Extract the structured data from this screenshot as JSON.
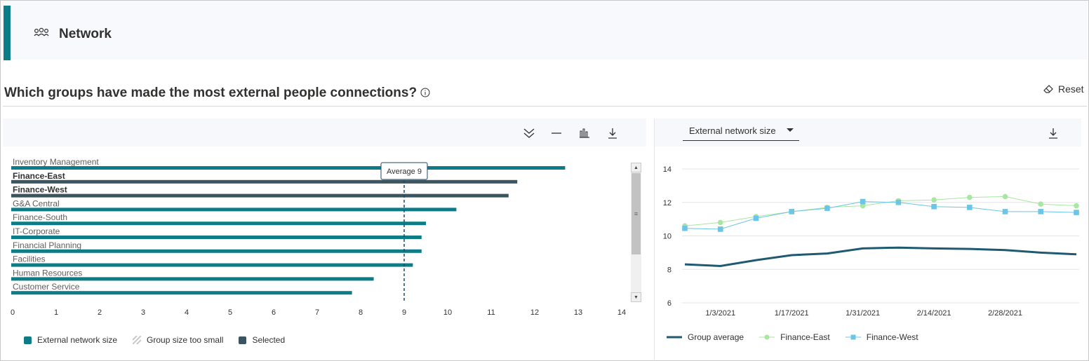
{
  "header": {
    "title": "Network",
    "icon": "people-group-icon"
  },
  "question": {
    "text": "Which groups have made the most external people connections?",
    "info_icon": "info-icon"
  },
  "reset": {
    "label": "Reset",
    "icon": "eraser-icon"
  },
  "left_toolbar": {
    "icons": [
      "expand-all-icon",
      "minimize-icon",
      "bar-chart-icon",
      "download-icon"
    ]
  },
  "right_toolbar": {
    "icons": [
      "download-icon"
    ]
  },
  "colors": {
    "teal": "#0e7c86",
    "selected": "#3a5460",
    "avg_line": "#1d4a66",
    "group_avg": "#1f5a72",
    "finance_east": "#a8e6a1",
    "finance_west": "#6cc4e6"
  },
  "chart_data": [
    {
      "type": "bar",
      "orientation": "horizontal",
      "categories": [
        "Inventory Management",
        "Finance-East",
        "Finance-West",
        "G&A Central",
        "Finance-South",
        "IT-Corporate",
        "Financial Planning",
        "Facilities",
        "Human Resources",
        "Customer Service"
      ],
      "values": [
        12.7,
        11.6,
        11.4,
        10.2,
        9.5,
        9.4,
        9.4,
        9.2,
        8.3,
        7.8
      ],
      "selected": [
        false,
        true,
        true,
        false,
        false,
        false,
        false,
        false,
        false,
        false
      ],
      "xlim": [
        0,
        14
      ],
      "xticks": [
        "0",
        "1",
        "2",
        "3",
        "4",
        "5",
        "6",
        "7",
        "8",
        "9",
        "10",
        "11",
        "12",
        "13",
        "14"
      ],
      "average": {
        "value": 9,
        "label": "Average 9"
      },
      "legend": [
        {
          "label": "External network size",
          "color": "#0e7c86",
          "kind": "solid"
        },
        {
          "label": "Group size too small",
          "color": "#c8c8c8",
          "kind": "hatched"
        },
        {
          "label": "Selected",
          "color": "#3a5460",
          "kind": "solid"
        }
      ]
    },
    {
      "type": "line",
      "metric_selector": "External network size",
      "x": [
        "2020-12-27",
        "2021-01-03",
        "2021-01-10",
        "2021-01-17",
        "2021-01-24",
        "2021-01-31",
        "2021-02-07",
        "2021-02-14",
        "2021-02-21",
        "2021-02-28",
        "2021-03-07",
        "2021-03-14"
      ],
      "xticks": [
        "1/3/2021",
        "1/17/2021",
        "1/31/2021",
        "2/14/2021",
        "2/28/2021"
      ],
      "ylim": [
        6,
        14
      ],
      "yticks": [
        "6",
        "8",
        "10",
        "12",
        "14"
      ],
      "series": [
        {
          "name": "Group average",
          "color": "#1f5a72",
          "marker": "none",
          "values": [
            8.3,
            8.2,
            8.55,
            8.85,
            8.95,
            9.25,
            9.3,
            9.25,
            9.22,
            9.15,
            9.0,
            8.9
          ]
        },
        {
          "name": "Finance-East",
          "color": "#a8e6a1",
          "marker": "circle",
          "values": [
            10.6,
            10.8,
            11.15,
            11.45,
            11.7,
            11.8,
            12.1,
            12.15,
            12.3,
            12.35,
            11.9,
            11.8
          ]
        },
        {
          "name": "Finance-West",
          "color": "#6cc4e6",
          "marker": "square",
          "values": [
            10.45,
            10.4,
            11.05,
            11.45,
            11.65,
            12.05,
            12.0,
            11.75,
            11.7,
            11.45,
            11.45,
            11.4
          ]
        }
      ]
    }
  ]
}
